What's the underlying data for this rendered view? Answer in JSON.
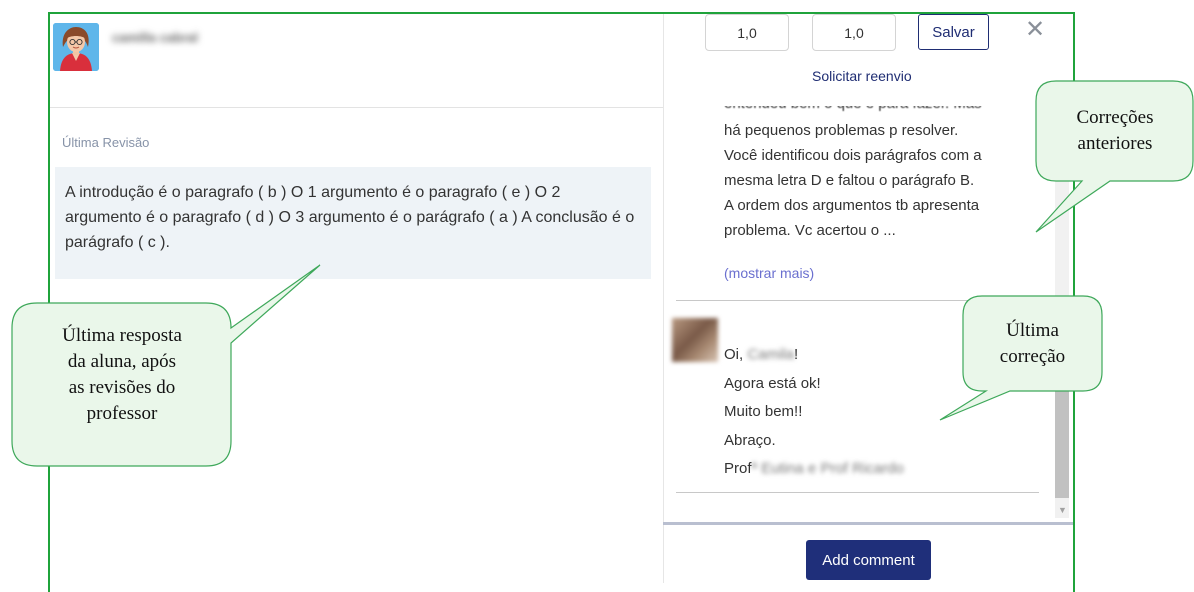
{
  "student": {
    "name": "camilla cabral"
  },
  "left": {
    "revision_label": "Última Revisão",
    "answer": "A introdução é o paragrafo ( b ) O 1 argumento é o paragrafo ( e ) O 2 argumento é o paragrafo ( d ) O 3 argumento é o parágrafo ( a ) A conclusão é o parágrafo ( c )."
  },
  "grading": {
    "grade1": "1,0",
    "grade2": "1,0",
    "save_label": "Salvar",
    "close_glyph": "✕",
    "resend_label": "Solicitar reenvio"
  },
  "previous_comment": {
    "cut_line": "entendeu bem o que é para fazer. Mas",
    "lines": [
      "há pequenos problemas p resolver.",
      "Você identificou dois parágrafos com a",
      "mesma letra D e faltou o parágrafo B.",
      "A ordem dos argumentos tb apresenta",
      "problema. Vc acertou o ..."
    ],
    "show_more": "(mostrar mais)"
  },
  "latest_comment": {
    "greeting_prefix": "Oi, ",
    "greeting_name": "Camila",
    "greeting_suffix": "!",
    "line2": "Agora está ok!",
    "line3": "Muito bem!!",
    "line4": "Abraço.",
    "sign_prefix": "Prof",
    "sign_name": "ª Eutina e Prof Ricardo"
  },
  "add_comment_label": "Add comment",
  "callouts": {
    "student_answer": [
      "Última resposta",
      "da aluna, após",
      "as revisões do",
      "professor"
    ],
    "previous": [
      "Correções",
      "anteriores"
    ],
    "latest": [
      "Última",
      "correção"
    ]
  },
  "colors": {
    "frame": "#1fa33b",
    "brand": "#1f2f7a",
    "callout_fill": "#eaf7ea",
    "callout_stroke": "#3ea85a"
  }
}
